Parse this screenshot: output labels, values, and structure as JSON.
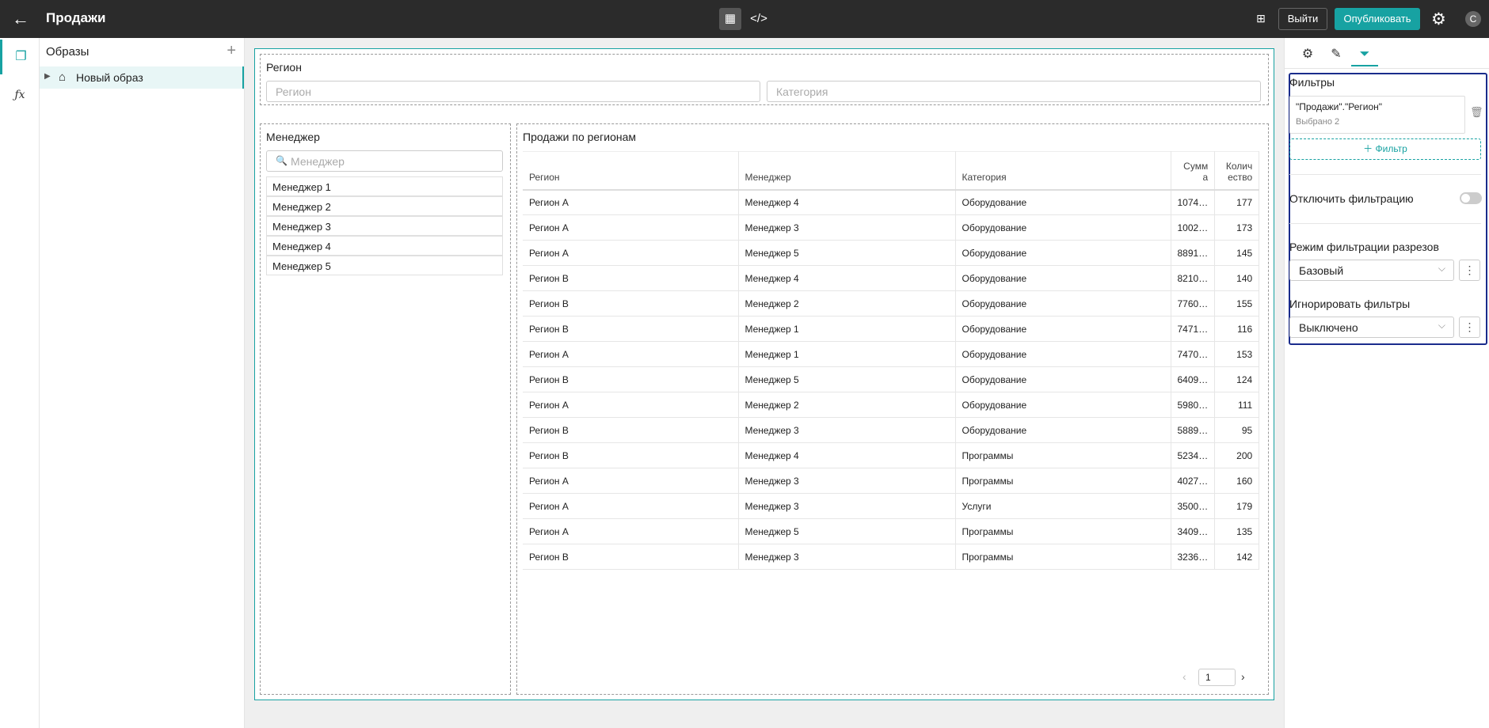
{
  "topbar": {
    "title": "Продажи",
    "exit_label": "Выйти",
    "publish_label": "Опубликовать",
    "avatar_letter": "С"
  },
  "tree": {
    "header": "Образы",
    "item": "Новый образ"
  },
  "region_widget": {
    "label": "Регион",
    "region_placeholder": "Регион",
    "category_placeholder": "Категория"
  },
  "manager_widget": {
    "label": "Менеджер",
    "search_placeholder": "Менеджер",
    "items": [
      "Менеджер 1",
      "Менеджер 2",
      "Менеджер 3",
      "Менеджер 4",
      "Менеджер 5"
    ]
  },
  "sales_table": {
    "title": "Продажи по регионам",
    "columns": [
      "Регион",
      "Менеджер",
      "Категория",
      "Сумм а",
      "Колич ество"
    ],
    "rows": [
      [
        "Регион А",
        "Менеджер 4",
        "Оборудование",
        "1074…",
        "177"
      ],
      [
        "Регион А",
        "Менеджер 3",
        "Оборудование",
        "1002…",
        "173"
      ],
      [
        "Регион А",
        "Менеджер 5",
        "Оборудование",
        "8891…",
        "145"
      ],
      [
        "Регион B",
        "Менеджер 4",
        "Оборудование",
        "8210…",
        "140"
      ],
      [
        "Регион B",
        "Менеджер 2",
        "Оборудование",
        "7760…",
        "155"
      ],
      [
        "Регион B",
        "Менеджер 1",
        "Оборудование",
        "7471…",
        "116"
      ],
      [
        "Регион А",
        "Менеджер 1",
        "Оборудование",
        "7470…",
        "153"
      ],
      [
        "Регион B",
        "Менеджер 5",
        "Оборудование",
        "6409…",
        "124"
      ],
      [
        "Регион А",
        "Менеджер 2",
        "Оборудование",
        "5980…",
        "111"
      ],
      [
        "Регион B",
        "Менеджер 3",
        "Оборудование",
        "5889…",
        "95"
      ],
      [
        "Регион B",
        "Менеджер 4",
        "Программы",
        "5234…",
        "200"
      ],
      [
        "Регион А",
        "Менеджер 3",
        "Программы",
        "4027…",
        "160"
      ],
      [
        "Регион А",
        "Менеджер 3",
        "Услуги",
        "3500…",
        "179"
      ],
      [
        "Регион А",
        "Менеджер 5",
        "Программы",
        "3409…",
        "135"
      ],
      [
        "Регион B",
        "Менеджер 3",
        "Программы",
        "3236…",
        "142"
      ]
    ],
    "page": "1"
  },
  "right_panel": {
    "filters_title": "Фильтры",
    "filter_name": "\"Продажи\".\"Регион\"",
    "filter_selected": "Выбрано 2",
    "add_filter_label": "Фильтр",
    "disable_filtering_label": "Отключить фильтрацию",
    "slice_mode_label": "Режим фильтрации разрезов",
    "slice_mode_value": "Базовый",
    "ignore_filters_label": "Игнорировать фильтры",
    "ignore_filters_value": "Выключено"
  },
  "colors": {
    "accent": "#17a2a2",
    "topbar": "#2b2b2b",
    "focus_border": "#1a2c8c"
  }
}
